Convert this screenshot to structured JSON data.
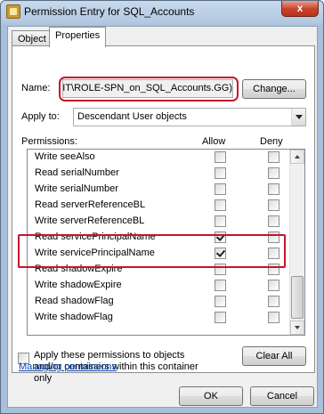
{
  "window": {
    "title": "Permission Entry for SQL_Accounts",
    "close_label": "x"
  },
  "tabs": [
    {
      "label": "Object",
      "active": false
    },
    {
      "label": "Properties",
      "active": true
    }
  ],
  "name": {
    "label": "Name:",
    "value": "KIT\\ROLE-SPN_on_SQL_Accounts.GG)",
    "change_button": "Change..."
  },
  "apply_to": {
    "label": "Apply to:",
    "value": "Descendant User objects"
  },
  "permissions": {
    "label": "Permissions:",
    "allow_header": "Allow",
    "deny_header": "Deny",
    "rows": [
      {
        "name": "Write seeAlso",
        "allow": false,
        "deny": false
      },
      {
        "name": "Read serialNumber",
        "allow": false,
        "deny": false
      },
      {
        "name": "Write serialNumber",
        "allow": false,
        "deny": false
      },
      {
        "name": "Read serverReferenceBL",
        "allow": false,
        "deny": false
      },
      {
        "name": "Write serverReferenceBL",
        "allow": false,
        "deny": false
      },
      {
        "name": "Read servicePrincipalName",
        "allow": true,
        "deny": false
      },
      {
        "name": "Write servicePrincipalName",
        "allow": true,
        "deny": false
      },
      {
        "name": "Read shadowExpire",
        "allow": false,
        "deny": false
      },
      {
        "name": "Write shadowExpire",
        "allow": false,
        "deny": false
      },
      {
        "name": "Read shadowFlag",
        "allow": false,
        "deny": false
      },
      {
        "name": "Write shadowFlag",
        "allow": false,
        "deny": false
      }
    ]
  },
  "apply_inherit": {
    "label": "Apply these permissions to objects and/or containers within this container only",
    "checked": false,
    "clear_all": "Clear All"
  },
  "managing_link": "Managing permissions",
  "buttons": {
    "ok": "OK",
    "cancel": "Cancel"
  }
}
